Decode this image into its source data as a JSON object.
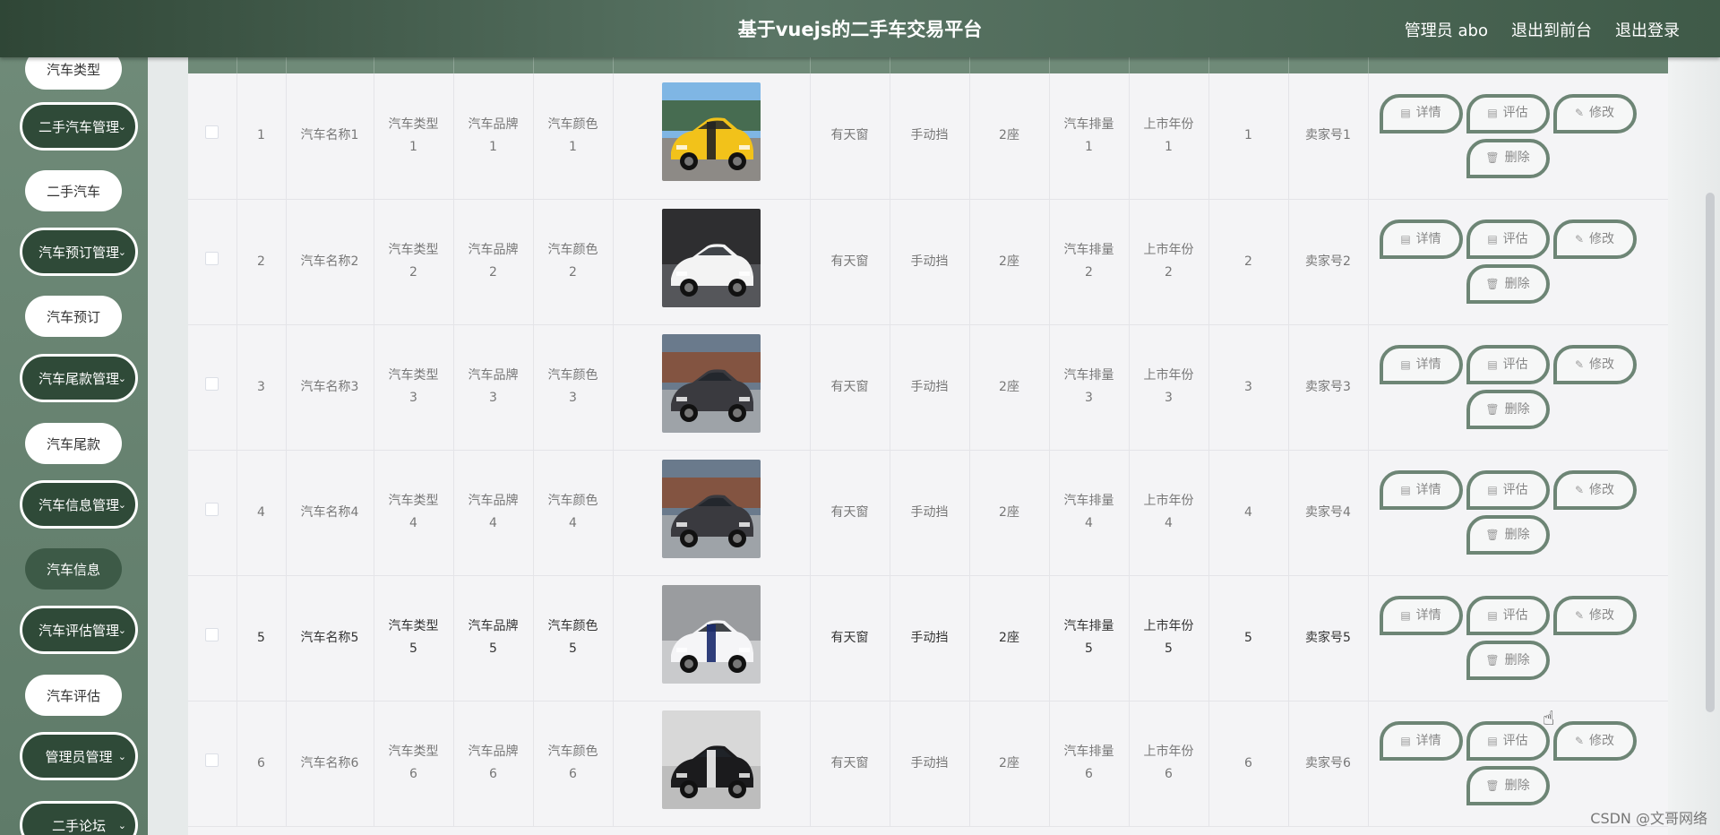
{
  "header": {
    "title": "基于vuejs的二手车交易平台",
    "user": "管理员 abo",
    "to_front": "退出到前台",
    "logout": "退出登录"
  },
  "sidebar": {
    "items": [
      {
        "label": "汽车类型",
        "kind": "sub"
      },
      {
        "label": "二手汽车管理",
        "kind": "group"
      },
      {
        "label": "二手汽车",
        "kind": "sub"
      },
      {
        "label": "汽车预订管理",
        "kind": "group"
      },
      {
        "label": "汽车预订",
        "kind": "sub"
      },
      {
        "label": "汽车尾款管理",
        "kind": "group"
      },
      {
        "label": "汽车尾款",
        "kind": "sub"
      },
      {
        "label": "汽车信息管理",
        "kind": "group"
      },
      {
        "label": "汽车信息",
        "kind": "sub-active"
      },
      {
        "label": "汽车评估管理",
        "kind": "group"
      },
      {
        "label": "汽车评估",
        "kind": "sub"
      },
      {
        "label": "管理员管理",
        "kind": "group"
      },
      {
        "label": "二手论坛",
        "kind": "group"
      }
    ]
  },
  "table": {
    "rows": [
      {
        "idx": "1",
        "name": "汽车名称1",
        "type": "汽车类型",
        "type_n": "1",
        "brand": "汽车品牌",
        "brand_n": "1",
        "color": "汽车颜色",
        "color_n": "1",
        "sunroof": "有天窗",
        "gear": "手动挡",
        "seats": "2座",
        "disp": "汽车排量",
        "disp_n": "1",
        "year": "上市年份",
        "year_n": "1",
        "num": "1",
        "seller": "卖家号1",
        "img": "yellow-sports-car"
      },
      {
        "idx": "2",
        "name": "汽车名称2",
        "type": "汽车类型",
        "type_n": "2",
        "brand": "汽车品牌",
        "brand_n": "2",
        "color": "汽车颜色",
        "color_n": "2",
        "sunroof": "有天窗",
        "gear": "手动挡",
        "seats": "2座",
        "disp": "汽车排量",
        "disp_n": "2",
        "year": "上市年份",
        "year_n": "2",
        "num": "2",
        "seller": "卖家号2",
        "img": "white-sedan"
      },
      {
        "idx": "3",
        "name": "汽车名称3",
        "type": "汽车类型",
        "type_n": "3",
        "brand": "汽车品牌",
        "brand_n": "3",
        "color": "汽车颜色",
        "color_n": "3",
        "sunroof": "有天窗",
        "gear": "手动挡",
        "seats": "2座",
        "disp": "汽车排量",
        "disp_n": "3",
        "year": "上市年份",
        "year_n": "3",
        "num": "3",
        "seller": "卖家号3",
        "img": "dark-sedan"
      },
      {
        "idx": "4",
        "name": "汽车名称4",
        "type": "汽车类型",
        "type_n": "4",
        "brand": "汽车品牌",
        "brand_n": "4",
        "color": "汽车颜色",
        "color_n": "4",
        "sunroof": "有天窗",
        "gear": "手动挡",
        "seats": "2座",
        "disp": "汽车排量",
        "disp_n": "4",
        "year": "上市年份",
        "year_n": "4",
        "num": "4",
        "seller": "卖家号4",
        "img": "dark-sedan"
      },
      {
        "idx": "5",
        "name": "汽车名称5",
        "type": "汽车类型",
        "type_n": "5",
        "brand": "汽车品牌",
        "brand_n": "5",
        "color": "汽车颜色",
        "color_n": "5",
        "sunroof": "有天窗",
        "gear": "手动挡",
        "seats": "2座",
        "disp": "汽车排量",
        "disp_n": "5",
        "year": "上市年份",
        "year_n": "5",
        "num": "5",
        "seller": "卖家号5",
        "img": "white-concept-car"
      },
      {
        "idx": "6",
        "name": "汽车名称6",
        "type": "汽车类型",
        "type_n": "6",
        "brand": "汽车品牌",
        "brand_n": "6",
        "color": "汽车颜色",
        "color_n": "6",
        "sunroof": "有天窗",
        "gear": "手动挡",
        "seats": "2座",
        "disp": "汽车排量",
        "disp_n": "6",
        "year": "上市年份",
        "year_n": "6",
        "num": "6",
        "seller": "卖家号6",
        "img": "black-muscle-car"
      }
    ],
    "actions": {
      "detail": "详情",
      "assess": "评估",
      "edit": "修改",
      "delete": "删除"
    }
  },
  "watermark": "CSDN @文哥网络",
  "colors": {
    "accent": "#6d8575",
    "sidebar_dark": "#2f4a38",
    "header": "#3f5a48"
  }
}
